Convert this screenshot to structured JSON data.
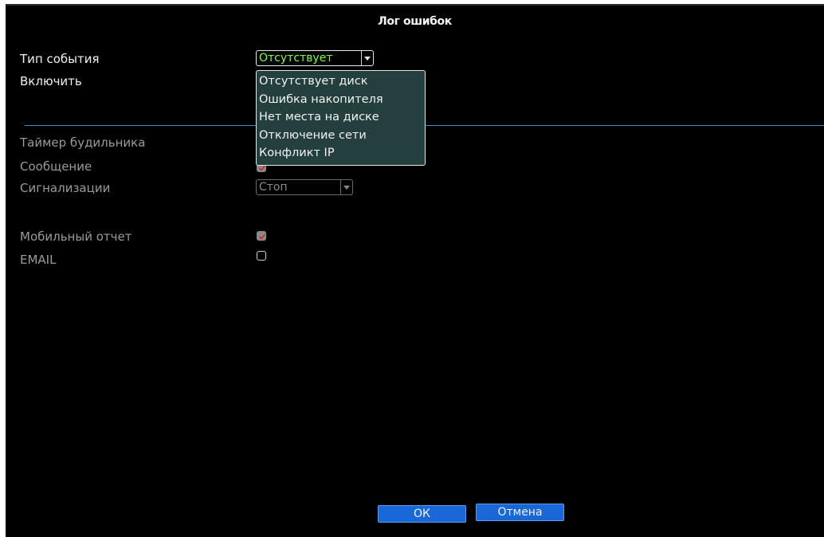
{
  "window": {
    "title": "Лог ошибок"
  },
  "form": {
    "event_type": {
      "label": "Тип события",
      "selected": "Отсутствует",
      "options": [
        "Отсутствует диск",
        "Ошибка накопителя",
        "Нет места на диске",
        "Отключение сети",
        "Конфликт IP"
      ]
    },
    "enable": {
      "label": "Включить"
    },
    "alarm_timer": {
      "label": "Таймер будильника"
    },
    "message": {
      "label": "Сообщение",
      "checked": true
    },
    "alarms": {
      "label": "Сигнализации",
      "selected": "Стоп"
    },
    "mobile_report": {
      "label": "Мобильный отчет",
      "checked": true
    },
    "email": {
      "label": "EMAIL",
      "checked": false
    }
  },
  "buttons": {
    "ok": "ОК",
    "cancel": "Отмена"
  },
  "colors": {
    "background": "#000000",
    "accent_blue": "#1a68d8",
    "divider": "#3f8bd6",
    "selected_value": "#7dff3d",
    "dropdown_bg": "#23403f",
    "check_mark": "#e02020"
  }
}
